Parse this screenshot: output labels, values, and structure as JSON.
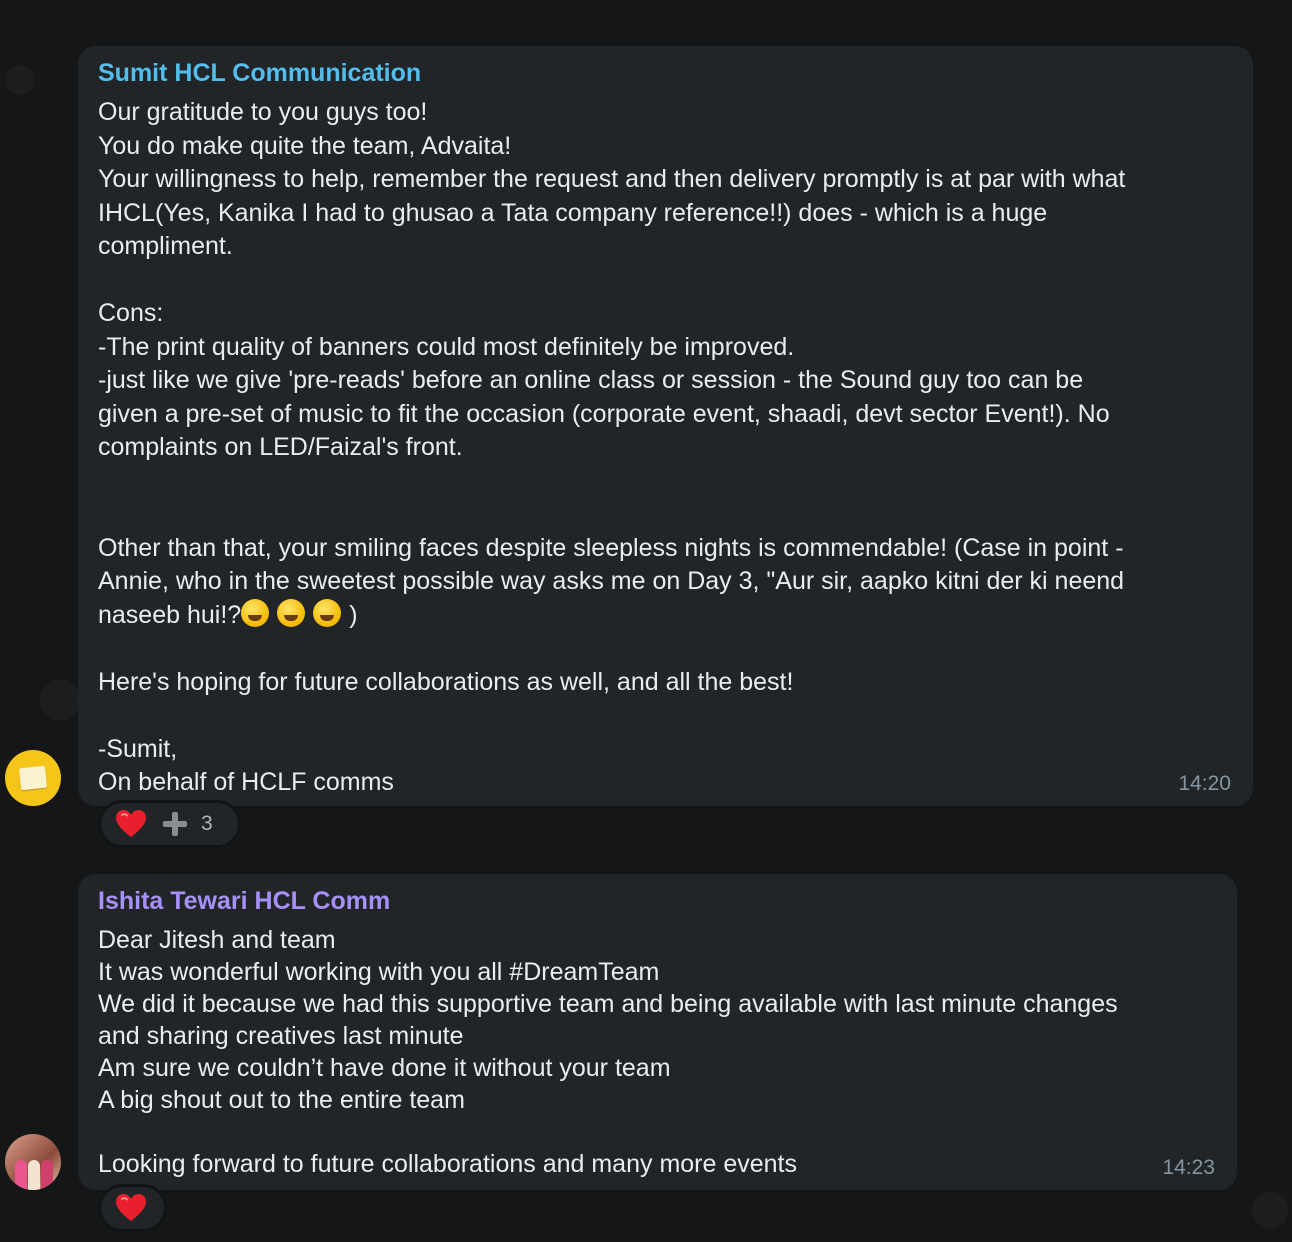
{
  "messages": [
    {
      "sender": "Sumit HCL Communication",
      "sender_color": "#53bdeb",
      "lines": [
        "Our gratitude to you guys too!",
        "You do make quite the team, Advaita!",
        "Your willingness to help, remember the request and then delivery promptly is at par with what",
        "IHCL(Yes, Kanika I had to ghusao a Tata company reference!!) does - which is a huge",
        "compliment.",
        "",
        "Cons:",
        "-The print quality of banners could most definitely be improved.",
        "-just like we give 'pre-reads' before an online class or session - the Sound guy too can be",
        "given a pre-set of music to fit the occasion (corporate event, shaadi, devt sector Event!). No",
        "complaints on LED/Faizal's front.",
        "",
        "",
        "Other than that, your smiling faces despite sleepless nights is commendable! (Case in point -",
        "Annie, who in the sweetest possible way asks me on Day 3, \"Aur sir, aapko kitni der ki neend",
        "naseeb hui!?",
        "",
        "Here's hoping for future collaborations as well, and all the best!",
        "",
        "-Sumit,",
        "On behalf of HCLF comms"
      ],
      "emoji_suffix": ")",
      "emojis": [
        "grinning-sweat-emoji",
        "loudly-crying-emoji",
        "rolling-laughing-emoji"
      ],
      "time": "14:20",
      "reaction": {
        "icon": "heart-icon",
        "count": "3"
      }
    },
    {
      "sender": "Ishita Tewari HCL Comm",
      "sender_color": "#a791f8",
      "lines": [
        "Dear Jitesh and team",
        "It was wonderful working with you all #DreamTeam",
        "We did it because we had this supportive team and being available with last minute changes",
        "and sharing creatives last minute",
        "Am sure we couldn’t have done it without your team",
        "A big shout out to the entire team",
        "",
        "Looking forward to future collaborations and many more events"
      ],
      "time": "14:23",
      "reaction": {
        "icon": "heart-icon"
      }
    }
  ]
}
